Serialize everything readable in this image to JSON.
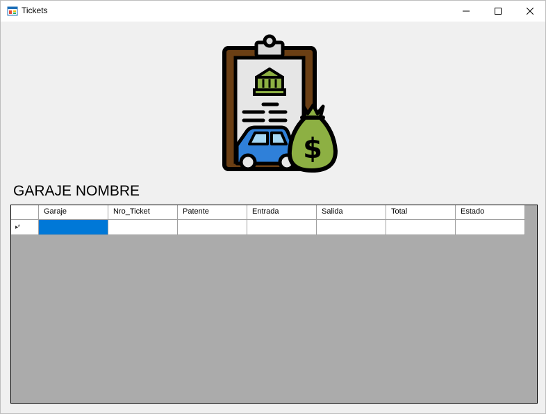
{
  "window": {
    "title": "Tickets",
    "icons": {
      "app": "app-icon",
      "minimize": "minimize-icon",
      "maximize": "maximize-icon",
      "close": "close-icon"
    }
  },
  "logo": {
    "icon": "parking-ticket-money-icon"
  },
  "heading": "GARAJE NOMBRE",
  "table": {
    "columns": [
      "Garaje",
      "Nro_Ticket",
      "Patente",
      "Entrada",
      "Salida",
      "Total",
      "Estado"
    ],
    "new_row_marker": "▸*",
    "rows": [
      [
        "",
        "",
        "",
        "",
        "",
        "",
        ""
      ]
    ],
    "selected_cell": "Garaje"
  },
  "colors": {
    "selection": "#0078d7",
    "grid_background": "#ababab",
    "window_background": "#f0f0f0"
  }
}
